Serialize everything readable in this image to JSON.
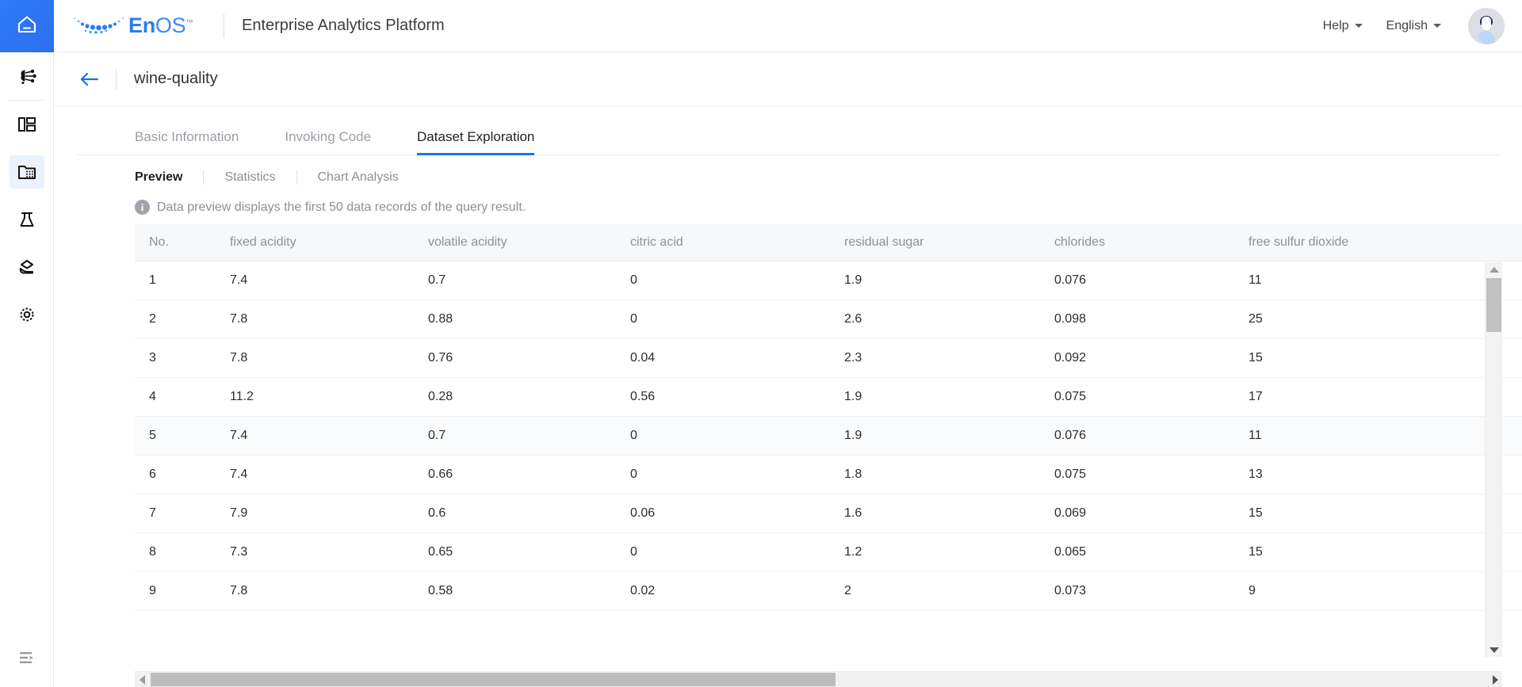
{
  "sidebar": {
    "items": [
      {
        "name": "home",
        "icon": "home-icon",
        "active": true
      },
      {
        "name": "ai-model",
        "icon": "brain-network-icon",
        "active": false
      },
      {
        "name": "dashboard",
        "icon": "dashboard-layout-icon",
        "active": false
      },
      {
        "name": "dataset",
        "icon": "data-folder-icon",
        "active": true
      },
      {
        "name": "lab",
        "icon": "flask-icon",
        "active": false
      },
      {
        "name": "service",
        "icon": "hand-service-icon",
        "active": false
      },
      {
        "name": "settings",
        "icon": "gear-target-icon",
        "active": false
      }
    ],
    "collapse_icon": "collapse-menu-icon"
  },
  "header": {
    "logo_text_en": "En",
    "logo_text_os": "OS",
    "logo_tm": "™",
    "app_title": "Enterprise Analytics Platform",
    "help_label": "Help",
    "language_label": "English",
    "avatar_name": "user-avatar"
  },
  "breadcrumb": {
    "back_icon": "back-arrow-icon",
    "title": "wine-quality"
  },
  "tabs": [
    {
      "label": "Basic Information",
      "active": false
    },
    {
      "label": "Invoking Code",
      "active": false
    },
    {
      "label": "Dataset Exploration",
      "active": true
    }
  ],
  "subtabs": [
    {
      "label": "Preview",
      "active": true
    },
    {
      "label": "Statistics",
      "active": false
    },
    {
      "label": "Chart Analysis",
      "active": false
    }
  ],
  "notice": {
    "icon": "info-icon",
    "text": "Data preview displays the first 50 data records of the query result."
  },
  "table": {
    "columns": [
      "No.",
      "fixed acidity",
      "volatile acidity",
      "citric acid",
      "residual sugar",
      "chlorides",
      "free sulfur dioxide"
    ],
    "rows": [
      [
        "1",
        "7.4",
        "0.7",
        "0",
        "1.9",
        "0.076",
        "11"
      ],
      [
        "2",
        "7.8",
        "0.88",
        "0",
        "2.6",
        "0.098",
        "25"
      ],
      [
        "3",
        "7.8",
        "0.76",
        "0.04",
        "2.3",
        "0.092",
        "15"
      ],
      [
        "4",
        "11.2",
        "0.28",
        "0.56",
        "1.9",
        "0.075",
        "17"
      ],
      [
        "5",
        "7.4",
        "0.7",
        "0",
        "1.9",
        "0.076",
        "11"
      ],
      [
        "6",
        "7.4",
        "0.66",
        "0",
        "1.8",
        "0.075",
        "13"
      ],
      [
        "7",
        "7.9",
        "0.6",
        "0.06",
        "1.6",
        "0.069",
        "15"
      ],
      [
        "8",
        "7.3",
        "0.65",
        "0",
        "1.2",
        "0.065",
        "15"
      ],
      [
        "9",
        "7.8",
        "0.58",
        "0.02",
        "2",
        "0.073",
        "9"
      ]
    ]
  },
  "scrollbars": {
    "vertical_up_icon": "scroll-up-arrow-icon",
    "vertical_down_icon": "scroll-down-arrow-icon",
    "horizontal_left_icon": "scroll-left-arrow-icon",
    "horizontal_right_icon": "scroll-right-arrow-icon"
  },
  "colors": {
    "accent": "#1a73e8",
    "rail_active": "#2f7bf6",
    "header_bg": "#f7f8fa",
    "muted_text": "#8c9099"
  }
}
